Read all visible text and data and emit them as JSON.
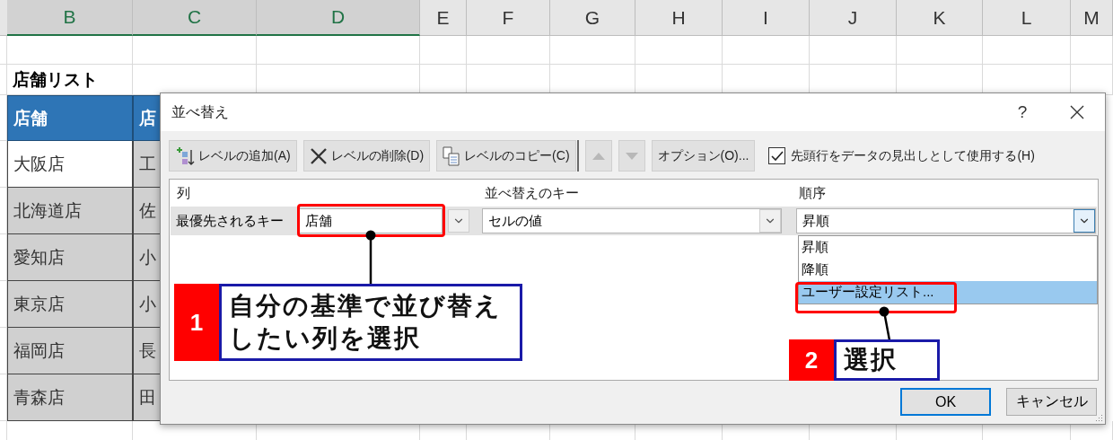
{
  "sheet": {
    "columns": [
      {
        "label": "B",
        "selected": true
      },
      {
        "label": "C",
        "selected": true
      },
      {
        "label": "D",
        "selected": true
      },
      {
        "label": "E",
        "selected": false
      },
      {
        "label": "F",
        "selected": false
      },
      {
        "label": "G",
        "selected": false
      },
      {
        "label": "H",
        "selected": false
      },
      {
        "label": "I",
        "selected": false
      },
      {
        "label": "J",
        "selected": false
      },
      {
        "label": "K",
        "selected": false
      },
      {
        "label": "L",
        "selected": false
      },
      {
        "label": "M",
        "selected": false
      }
    ],
    "title": "店舗リスト",
    "table_header": [
      "店舗",
      "店"
    ],
    "rows": [
      {
        "cells": [
          "大阪店",
          "工"
        ],
        "selected": true
      },
      {
        "cells": [
          "北海道店",
          "佐"
        ],
        "selected": false
      },
      {
        "cells": [
          "愛知店",
          "小"
        ],
        "selected": false
      },
      {
        "cells": [
          "東京店",
          "小"
        ],
        "selected": false
      },
      {
        "cells": [
          "福岡店",
          "長"
        ],
        "selected": false
      },
      {
        "cells": [
          "青森店",
          "田"
        ],
        "selected": false
      }
    ]
  },
  "dialog": {
    "title": "並べ替え",
    "help": "?",
    "toolbar": [
      {
        "kind": "add",
        "label": "レベルの追加(A)",
        "disabled": false
      },
      {
        "kind": "delete",
        "label": "レベルの削除(D)",
        "disabled": false
      },
      {
        "kind": "copy",
        "label": "レベルのコピー(C)",
        "disabled": false
      },
      {
        "kind": "up",
        "disabled": true
      },
      {
        "kind": "down",
        "disabled": true
      },
      {
        "kind": "options",
        "label": "オプション(O)...",
        "disabled": false
      }
    ],
    "header_checkbox": {
      "label": "先頭行をデータの見出しとして使用する(H)",
      "checked": true
    },
    "grid": {
      "columns": [
        "列",
        "並べ替えのキー",
        "順序"
      ],
      "level": {
        "label": "最優先されるキー",
        "column": "店舗",
        "key": "セルの値",
        "order": "昇順",
        "order_open": true
      },
      "order_options": [
        {
          "label": "昇順",
          "selected": false
        },
        {
          "label": "降順",
          "selected": false
        },
        {
          "label": "ユーザー設定リスト...",
          "selected": true
        }
      ]
    },
    "buttons": [
      {
        "label": "OK",
        "default": true
      },
      {
        "label": "キャンセル",
        "default": false
      }
    ]
  },
  "callouts": [
    {
      "number": "1",
      "text": "自分の基準で並び替えしたい列を選択"
    },
    {
      "number": "2",
      "text": "選択"
    }
  ]
}
